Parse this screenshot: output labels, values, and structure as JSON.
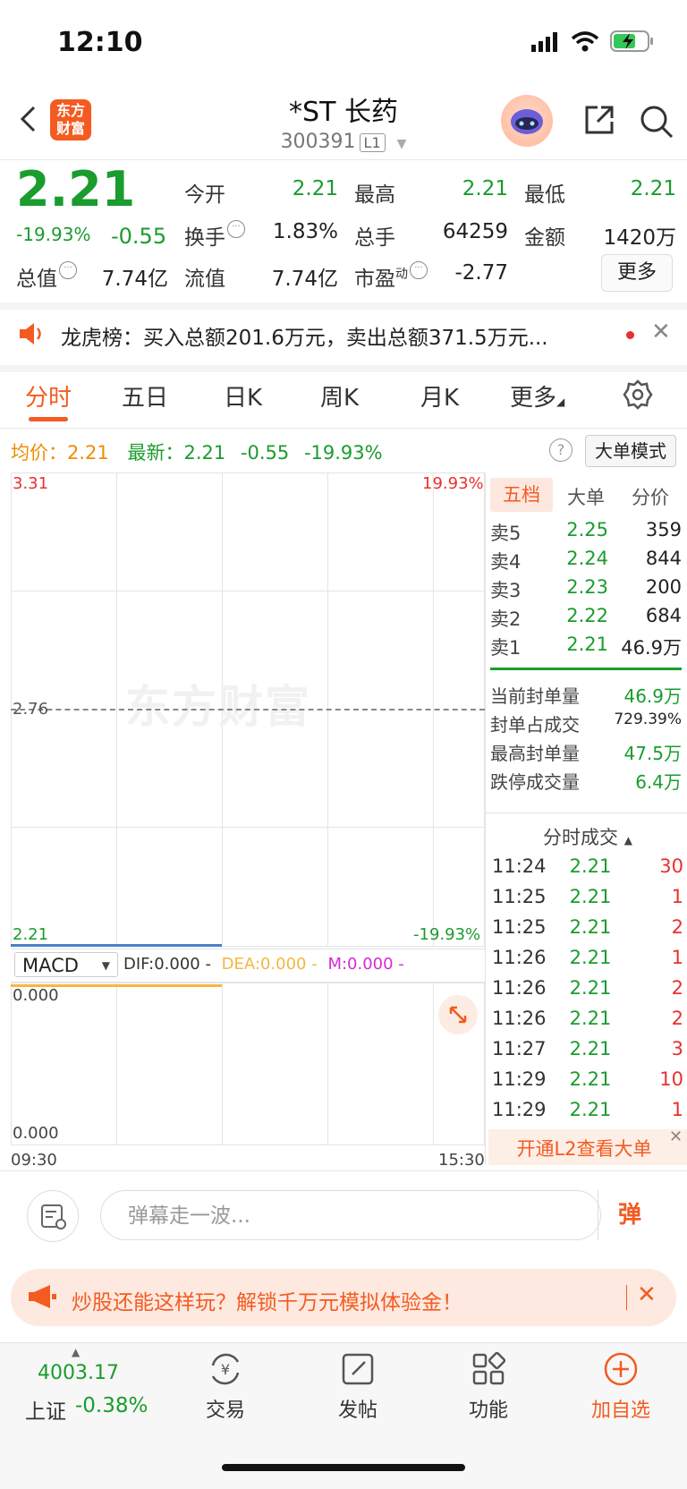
{
  "status_bar": {
    "time": "12:10"
  },
  "header": {
    "logo_text_1": "东方",
    "logo_text_2": "财富",
    "stock_name": "*ST 长药",
    "stock_code": "300391",
    "level_badge": "L1"
  },
  "quote": {
    "price": "2.21",
    "change_pct": "-19.93%",
    "change_abs": "-0.55",
    "fields": {
      "open_label": "今开",
      "open": "2.21",
      "high_label": "最高",
      "high": "2.21",
      "low_label": "最低",
      "low": "2.21",
      "turnover_label": "换手",
      "turnover": "1.83%",
      "volume_label": "总手",
      "volume": "64259",
      "amount_label": "金额",
      "amount": "1420万",
      "mktcap_label": "总值",
      "mktcap": "7.74亿",
      "float_label": "流值",
      "float": "7.74亿",
      "pe_label": "市盈",
      "pe_sup": "动",
      "pe": "-2.77"
    },
    "more_label": "更多"
  },
  "notice": {
    "text": "龙虎榜：买入总额201.6万元，卖出总额371.5万元..."
  },
  "tabs": {
    "items": [
      "分时",
      "五日",
      "日K",
      "周K",
      "月K",
      "更多"
    ]
  },
  "chart_info": {
    "avg_label": "均价：",
    "avg_value": "2.21",
    "latest_label": "最新：",
    "latest_value": "2.21",
    "latest_change": "-0.55",
    "latest_pct": "-19.93%",
    "help": "?",
    "big_order_mode": "大单模式"
  },
  "chart": {
    "watermark": "东方财富",
    "y_top": "3.31",
    "y_mid": "2.76",
    "y_bottom": "2.21",
    "pct_top": "19.93%",
    "pct_bottom": "-19.93%",
    "time_start": "09:30",
    "time_end": "15:30"
  },
  "macd": {
    "selector": "MACD",
    "dif": "DIF:0.000 -",
    "dea": "DEA:0.000 -",
    "m": "M:0.000 -",
    "y_top": "0.000",
    "y_bottom": "0.000"
  },
  "order_book": {
    "tabs": [
      "五档",
      "大单",
      "分价"
    ],
    "asks": [
      {
        "label": "卖5",
        "price": "2.25",
        "volume": "359"
      },
      {
        "label": "卖4",
        "price": "2.24",
        "volume": "844"
      },
      {
        "label": "卖3",
        "price": "2.23",
        "volume": "200"
      },
      {
        "label": "卖2",
        "price": "2.22",
        "volume": "684"
      },
      {
        "label": "卖1",
        "price": "2.21",
        "volume": "46.9万"
      }
    ],
    "seal": [
      {
        "label": "当前封单量",
        "value": "46.9万"
      },
      {
        "label": "封单占成交",
        "value": "729.39%"
      },
      {
        "label": "最高封单量",
        "value": "47.5万"
      },
      {
        "label": "跌停成交量",
        "value": "6.4万"
      }
    ]
  },
  "ticks": {
    "header": "分时成交",
    "rows": [
      {
        "time": "11:24",
        "price": "2.21",
        "volume": "30"
      },
      {
        "time": "11:25",
        "price": "2.21",
        "volume": "1"
      },
      {
        "time": "11:25",
        "price": "2.21",
        "volume": "2"
      },
      {
        "time": "11:26",
        "price": "2.21",
        "volume": "1"
      },
      {
        "time": "11:26",
        "price": "2.21",
        "volume": "2"
      },
      {
        "time": "11:26",
        "price": "2.21",
        "volume": "2"
      },
      {
        "time": "11:27",
        "price": "2.21",
        "volume": "3"
      },
      {
        "time": "11:29",
        "price": "2.21",
        "volume": "10"
      },
      {
        "time": "11:29",
        "price": "2.21",
        "volume": "1"
      }
    ],
    "l2_banner": "开通L2查看大单"
  },
  "comment": {
    "placeholder": "弹幕走一波...",
    "danmu": "弹"
  },
  "promo": {
    "text": "炒股还能这样玩？解锁千万元模拟体验金！"
  },
  "bottom_nav": {
    "index_value": "4003.17",
    "index_name": "上证",
    "index_change": "-0.38%",
    "items": [
      "交易",
      "发帖",
      "功能",
      "加自选"
    ]
  },
  "colors": {
    "down_green": "#1a9c2e",
    "up_red": "#e8302e",
    "brand_orange": "#f35b21",
    "avg_orange": "#f08c00"
  }
}
